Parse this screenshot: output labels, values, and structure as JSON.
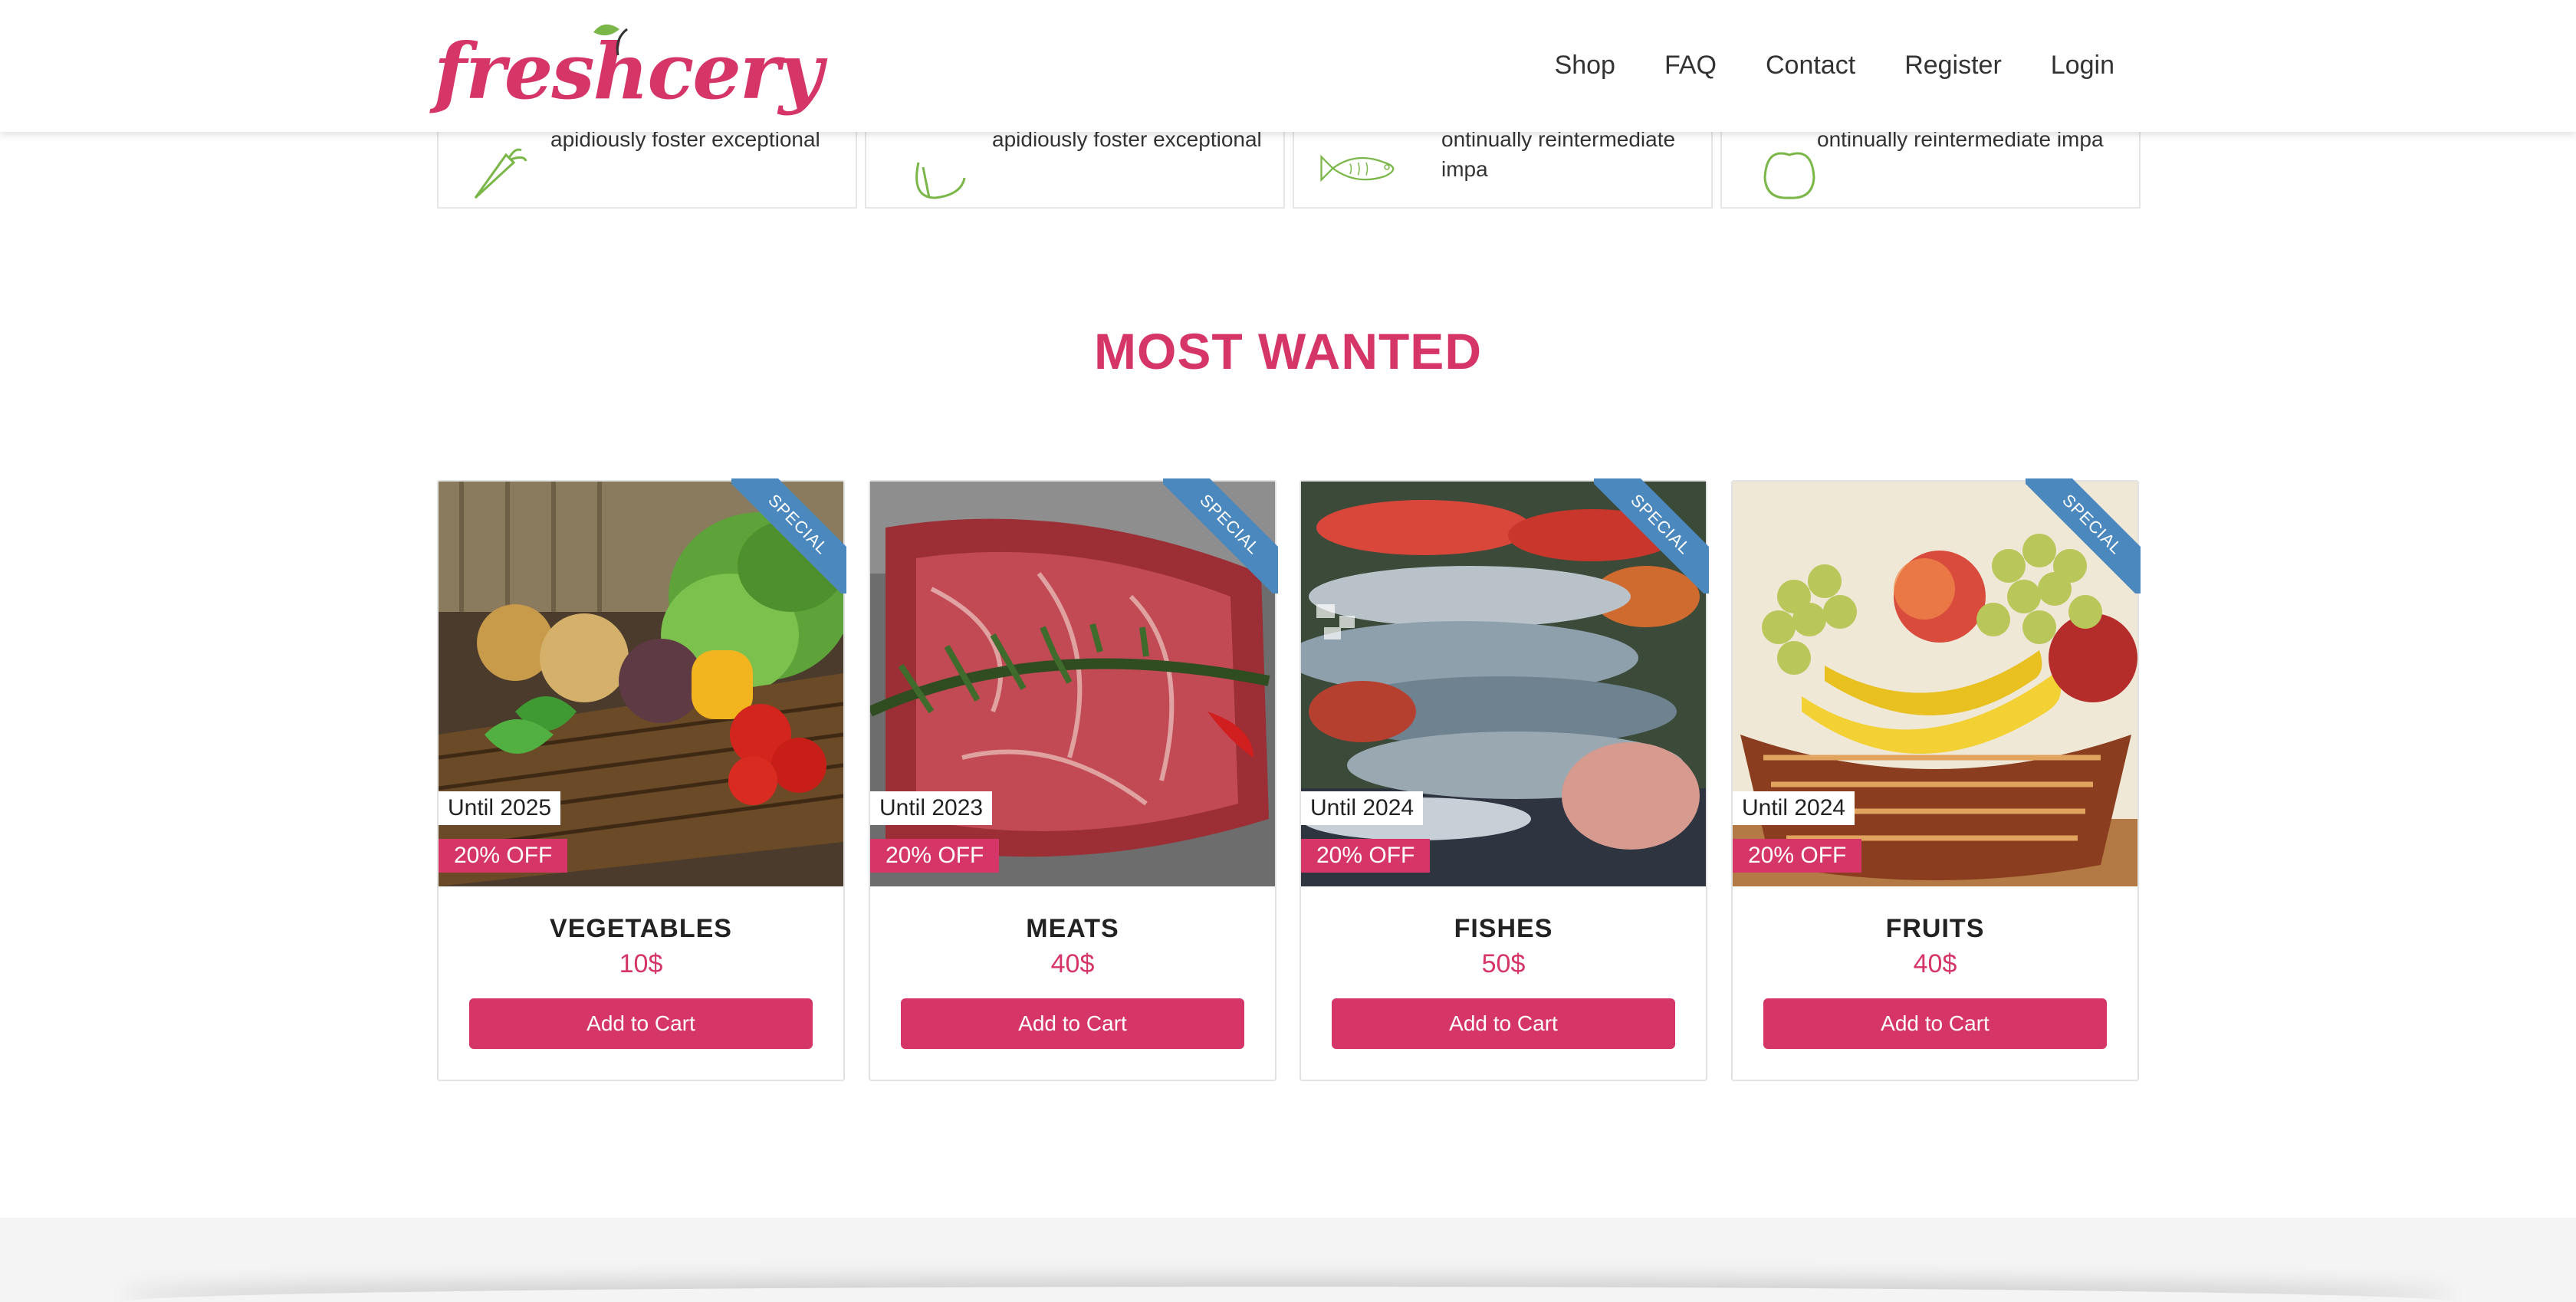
{
  "brand": {
    "logo_text": "freshcery",
    "brand_color": "#d63567",
    "leaf_color": "#7ab648"
  },
  "nav": {
    "items": [
      {
        "label": "Shop"
      },
      {
        "label": "FAQ"
      },
      {
        "label": "Contact"
      },
      {
        "label": "Register"
      },
      {
        "label": "Login"
      }
    ]
  },
  "features": [
    {
      "icon": "carrot-icon",
      "text": "apidiously foster exceptional"
    },
    {
      "icon": "meat-icon",
      "text": "apidiously foster exceptional"
    },
    {
      "icon": "fish-icon",
      "text": "ontinually reintermediate impa"
    },
    {
      "icon": "apple-icon",
      "text": "ontinually reintermediate impa"
    }
  ],
  "section": {
    "title": "MOST WANTED"
  },
  "products": [
    {
      "name": "VEGETABLES",
      "price": "10$",
      "until": "Until 2025",
      "discount": "20% OFF",
      "ribbon": "SPECIAL",
      "button": "Add to Cart"
    },
    {
      "name": "MEATS",
      "price": "40$",
      "until": "Until 2023",
      "discount": "20% OFF",
      "ribbon": "SPECIAL",
      "button": "Add to Cart"
    },
    {
      "name": "FISHES",
      "price": "50$",
      "until": "Until 2024",
      "discount": "20% OFF",
      "ribbon": "SPECIAL",
      "button": "Add to Cart"
    },
    {
      "name": "FRUITS",
      "price": "40$",
      "until": "Until 2024",
      "discount": "20% OFF",
      "ribbon": "SPECIAL",
      "button": "Add to Cart"
    }
  ],
  "colors": {
    "ribbon": "#4b88bd",
    "button": "#d63567"
  }
}
